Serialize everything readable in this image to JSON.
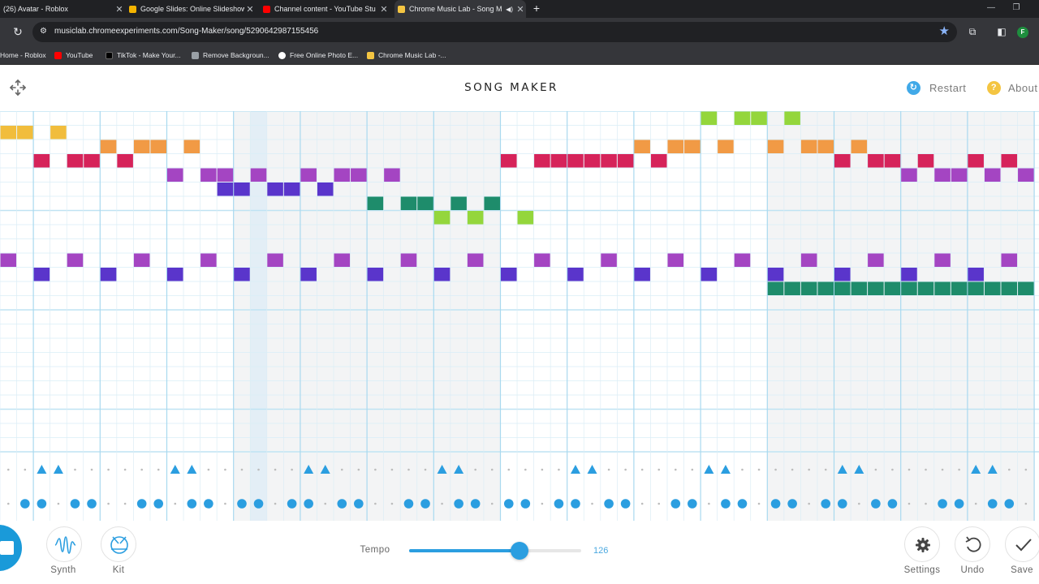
{
  "browser": {
    "tabs": [
      {
        "title": "(26) Avatar - Roblox",
        "favicon_color": "#5f6368",
        "active": false
      },
      {
        "title": "Google Slides: Online Slideshow",
        "favicon_color": "#f4b400",
        "active": false
      },
      {
        "title": "Channel content - YouTube Stu",
        "favicon_color": "#ff0000",
        "active": false
      },
      {
        "title": "Chrome Music Lab - Song M",
        "favicon_color": "#f4c542",
        "active": true
      }
    ],
    "url": "musiclab.chromeexperiments.com/Song-Maker/song/5290642987155456",
    "profile_initial": "F",
    "bookmarks": [
      {
        "title": "Home - Roblox",
        "icon_color": "none"
      },
      {
        "title": "YouTube",
        "icon_color": "#ff0000"
      },
      {
        "title": "TikTok - Make Your...",
        "icon_color": "#000000"
      },
      {
        "title": "Remove Backgroun...",
        "icon_color": "#9aa0a6"
      },
      {
        "title": "Free Online Photo E...",
        "icon_color": "#ffffff"
      },
      {
        "title": "Chrome Music Lab -...",
        "icon_color": "#f4c542"
      }
    ]
  },
  "app": {
    "title": "SONG MAKER",
    "restart_label": "Restart",
    "about_label": "About",
    "restart_color": "#41a9e8",
    "about_color": "#f4c542"
  },
  "grid": {
    "columns": 62,
    "melody_rows": 12,
    "playhead_column": 15,
    "colors": {
      "yellow": "#f1bd3c",
      "orange": "#f19a45",
      "red": "#d6235a",
      "violet": "#a445c2",
      "indigo": "#5a35cb",
      "teal": "#1e8c6b",
      "lime": "#94d63c",
      "blue": "#2b9ee0"
    },
    "melody_notes": [
      {
        "row": 0,
        "color": "lime",
        "cols": [
          42,
          44,
          45,
          47
        ]
      },
      {
        "row": 1,
        "color": "yellow",
        "cols": [
          0,
          1,
          3
        ]
      },
      {
        "row": 2,
        "color": "orange",
        "cols": [
          6,
          8,
          9,
          11,
          38,
          40,
          41,
          43,
          46,
          48,
          49,
          51
        ]
      },
      {
        "row": 3,
        "color": "red",
        "cols": [
          2,
          4,
          5,
          7,
          30,
          32,
          33,
          34,
          35,
          36,
          37,
          39,
          50,
          52,
          53,
          55,
          58,
          60
        ]
      },
      {
        "row": 4,
        "color": "violet",
        "cols": [
          10,
          12,
          13,
          15,
          18,
          20,
          21,
          23,
          54,
          56,
          57,
          59,
          61
        ]
      },
      {
        "row": 5,
        "color": "indigo",
        "cols": [
          13,
          14,
          16,
          17,
          19
        ]
      },
      {
        "row": 6,
        "color": "teal",
        "cols": [
          22,
          24,
          25,
          27,
          29
        ]
      },
      {
        "row": 7,
        "color": "lime",
        "cols": [
          26,
          28,
          31
        ]
      },
      {
        "row": 10,
        "color": "violet",
        "cols": [
          0,
          4,
          8,
          12,
          16,
          20,
          24,
          28,
          32,
          36,
          40,
          44,
          48,
          52,
          56,
          60
        ]
      },
      {
        "row": 11,
        "color": "indigo",
        "cols": [
          2,
          6,
          10,
          14,
          18,
          22,
          26,
          30,
          34,
          38,
          42,
          46,
          50,
          54,
          58
        ]
      },
      {
        "row": 12,
        "color": "teal",
        "cols": [
          46,
          47,
          48,
          49,
          50,
          51,
          52,
          53,
          54,
          55,
          56,
          57,
          58,
          59,
          60,
          61
        ]
      }
    ],
    "percussion": {
      "triangles": [
        2,
        3,
        10,
        11,
        18,
        19,
        26,
        27,
        34,
        35,
        42,
        43,
        50,
        51,
        58,
        59
      ],
      "circles": [
        1,
        2,
        4,
        5,
        8,
        9,
        11,
        12,
        14,
        15,
        17,
        18,
        20,
        21,
        24,
        25,
        27,
        28,
        30,
        31,
        33,
        34,
        36,
        37,
        40,
        41,
        43,
        44,
        46,
        47,
        49,
        50,
        52,
        53,
        56,
        57,
        59,
        60
      ]
    }
  },
  "controls": {
    "synth_label": "Synth",
    "kit_label": "Kit",
    "tempo_label": "Tempo",
    "tempo_value": "126",
    "tempo_fraction": 0.64,
    "settings_label": "Settings",
    "undo_label": "Undo",
    "save_label": "Save"
  }
}
